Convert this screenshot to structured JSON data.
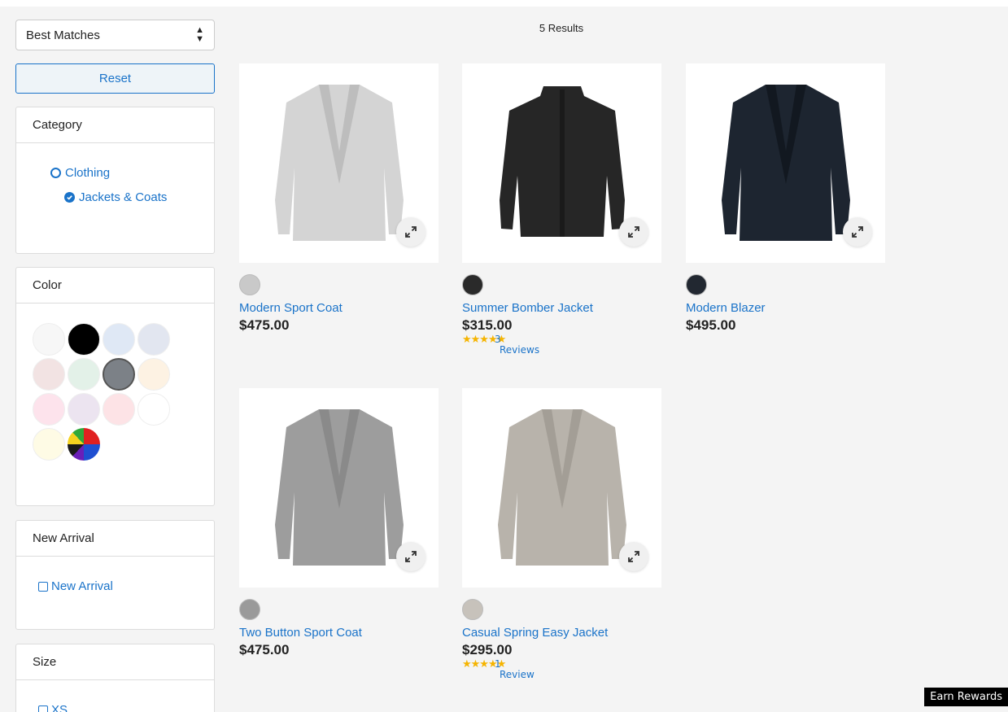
{
  "sort": {
    "selected": "Best Matches"
  },
  "reset_label": "Reset",
  "filters": {
    "category": {
      "title": "Category",
      "items": [
        {
          "label": "Clothing",
          "state": "unselected"
        },
        {
          "label": "Jackets & Coats",
          "state": "selected"
        }
      ]
    },
    "color": {
      "title": "Color",
      "swatches": [
        "#f7f7f7",
        "#000000",
        "#dfe8f5",
        "#e2e6f0",
        "#f2e3e3",
        "#e3f1e8",
        "#7c8187",
        "#fdf2e3",
        "#fde3ec",
        "#ece4f0",
        "#fde3e6",
        "#ffffff",
        "#fefbe5",
        "multicolor"
      ],
      "selected_index": 6
    },
    "new_arrival": {
      "title": "New Arrival",
      "item": "New Arrival"
    },
    "size": {
      "title": "Size",
      "item": "XS"
    }
  },
  "results_count": "5 Results",
  "products": [
    {
      "name": "Modern Sport Coat",
      "price": "$475.00",
      "swatch": "#c9c9c9",
      "jacket": "#d4d4d4",
      "lapel": "#bdbdbd",
      "style": "blazer"
    },
    {
      "name": "Summer Bomber Jacket",
      "price": "$315.00",
      "swatch": "#2a2a2a",
      "jacket": "#262626",
      "lapel": "#1a1a1a",
      "style": "bomber",
      "rating_count": "3",
      "rating_label": "Reviews"
    },
    {
      "name": "Modern Blazer",
      "price": "$495.00",
      "swatch": "#222831",
      "jacket": "#1d2530",
      "lapel": "#121820",
      "style": "blazer"
    },
    {
      "name": "Two Button Sport Coat",
      "price": "$475.00",
      "swatch": "#9a9a9a",
      "jacket": "#9d9d9d",
      "lapel": "#8a8a8a",
      "style": "blazer"
    },
    {
      "name": "Casual Spring Easy Jacket",
      "price": "$295.00",
      "swatch": "#c7c2bb",
      "jacket": "#b8b3ab",
      "lapel": "#a39e96",
      "style": "blazer",
      "rating_count": "1",
      "rating_label": "Review"
    }
  ],
  "stars": "★★★★★",
  "earn_rewards": "Earn Rewards"
}
